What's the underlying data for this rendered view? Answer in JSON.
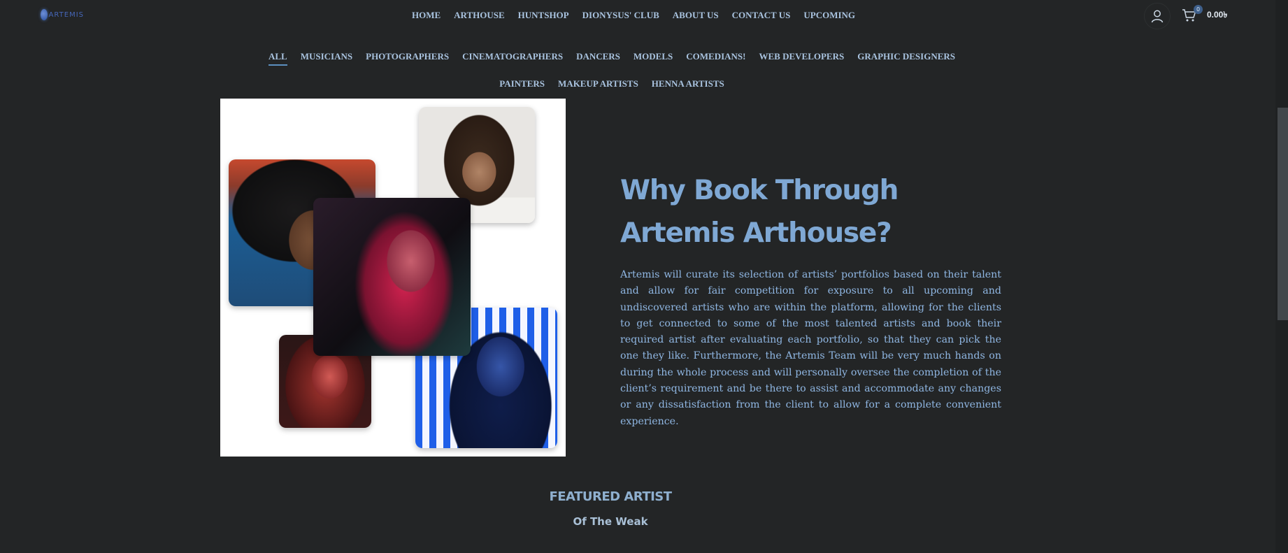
{
  "brand": {
    "logo_text": "ARTEMIS"
  },
  "main_nav": [
    {
      "label": "HOME"
    },
    {
      "label": "ARTHOUSE"
    },
    {
      "label": "HUNTSHOP"
    },
    {
      "label": "DIONYSUS' CLUB"
    },
    {
      "label": "ABOUT US"
    },
    {
      "label": "CONTACT US"
    },
    {
      "label": "UPCOMING"
    }
  ],
  "header_actions": {
    "account_icon": "user-icon",
    "cart_icon": "cart-icon",
    "cart_count": "0",
    "cart_total": "0.00৳"
  },
  "categories": [
    {
      "label": "ALL",
      "active": true
    },
    {
      "label": "MUSICIANS"
    },
    {
      "label": "PHOTOGRAPHERS"
    },
    {
      "label": "CINEMATOGRAPHERS"
    },
    {
      "label": "DANCERS"
    },
    {
      "label": "MODELS"
    },
    {
      "label": "COMEDIANS!"
    },
    {
      "label": "WEB DEVELOPERS"
    },
    {
      "label": "GRAPHIC DESIGNERS"
    },
    {
      "label": "PAINTERS"
    },
    {
      "label": "MAKEUP ARTISTS"
    },
    {
      "label": "HENNA ARTISTS"
    }
  ],
  "why": {
    "title": "Why Book Through Artemis Arthouse?",
    "body": "Artemis will curate its selection of artists’ portfolios based on their talent and allow for fair competition for exposure to all upcoming and undiscovered artists who are within the platform, allowing for the clients to get connected to some of the most talented artists and book their required artist after evaluating each portfolio, so that they can pick the one they like. Furthermore, the Artemis Team will be very much hands on during the whole process and will personally oversee the completion of the client’s requirement and be there to assist and accommodate any changes or any dissatisfaction from the client to allow for a complete convenient experience."
  },
  "featured": {
    "title": "FEATURED ARTIST",
    "subtitle": "Of The Weak"
  },
  "colors": {
    "background": "#232526",
    "nav_text": "#a9c3df",
    "accent_blue": "#7fa8d4",
    "body_text": "#8fb6e2"
  }
}
